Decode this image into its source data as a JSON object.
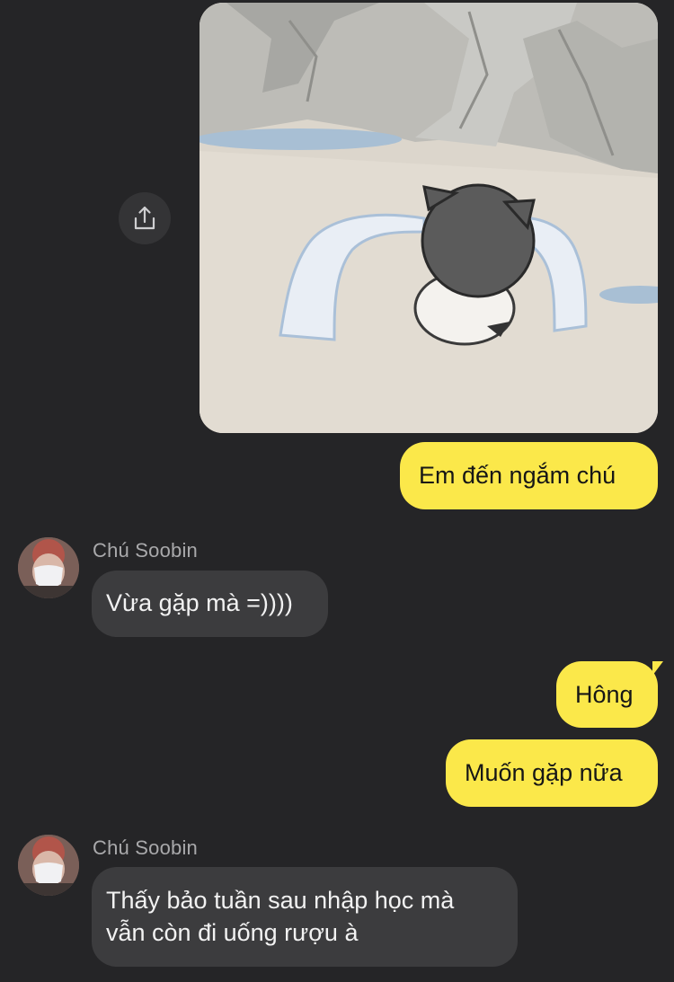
{
  "messages": {
    "m1_image": {
      "alt": "cartoon image",
      "share_icon": "share-icon"
    },
    "m2": {
      "text": "Em đến ngắm chú"
    },
    "m3": {
      "sender": "Chú Soobin",
      "text": "Vừa gặp mà =))))"
    },
    "m4": {
      "text": "Hông"
    },
    "m5": {
      "text": "Muốn gặp nữa"
    },
    "m6": {
      "sender": "Chú Soobin",
      "line1": "Thấy bảo tuần sau nhập học mà",
      "line2": "vẫn còn đi uống rượu à"
    }
  },
  "colors": {
    "background": "#252527",
    "outgoing_bubble": "#fbe84a",
    "incoming_bubble": "#3c3c3e",
    "sender_name": "#a9a9ab"
  }
}
